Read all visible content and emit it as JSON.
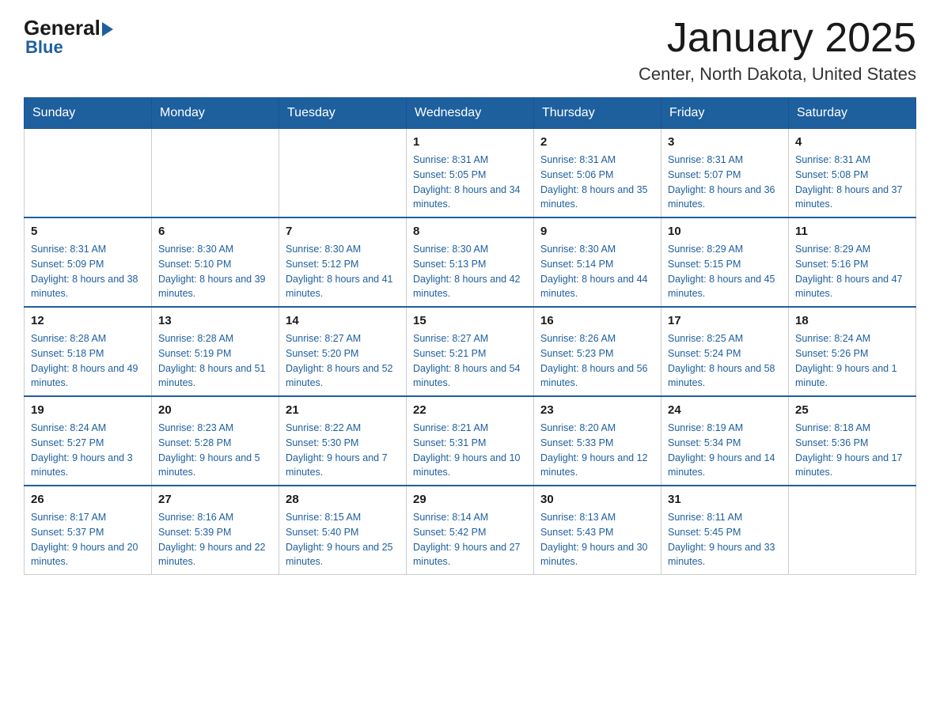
{
  "logo": {
    "general": "General",
    "blue": "Blue"
  },
  "title": "January 2025",
  "subtitle": "Center, North Dakota, United States",
  "days_of_week": [
    "Sunday",
    "Monday",
    "Tuesday",
    "Wednesday",
    "Thursday",
    "Friday",
    "Saturday"
  ],
  "weeks": [
    [
      {
        "day": "",
        "sunrise": "",
        "sunset": "",
        "daylight": ""
      },
      {
        "day": "",
        "sunrise": "",
        "sunset": "",
        "daylight": ""
      },
      {
        "day": "",
        "sunrise": "",
        "sunset": "",
        "daylight": ""
      },
      {
        "day": "1",
        "sunrise": "Sunrise: 8:31 AM",
        "sunset": "Sunset: 5:05 PM",
        "daylight": "Daylight: 8 hours and 34 minutes."
      },
      {
        "day": "2",
        "sunrise": "Sunrise: 8:31 AM",
        "sunset": "Sunset: 5:06 PM",
        "daylight": "Daylight: 8 hours and 35 minutes."
      },
      {
        "day": "3",
        "sunrise": "Sunrise: 8:31 AM",
        "sunset": "Sunset: 5:07 PM",
        "daylight": "Daylight: 8 hours and 36 minutes."
      },
      {
        "day": "4",
        "sunrise": "Sunrise: 8:31 AM",
        "sunset": "Sunset: 5:08 PM",
        "daylight": "Daylight: 8 hours and 37 minutes."
      }
    ],
    [
      {
        "day": "5",
        "sunrise": "Sunrise: 8:31 AM",
        "sunset": "Sunset: 5:09 PM",
        "daylight": "Daylight: 8 hours and 38 minutes."
      },
      {
        "day": "6",
        "sunrise": "Sunrise: 8:30 AM",
        "sunset": "Sunset: 5:10 PM",
        "daylight": "Daylight: 8 hours and 39 minutes."
      },
      {
        "day": "7",
        "sunrise": "Sunrise: 8:30 AM",
        "sunset": "Sunset: 5:12 PM",
        "daylight": "Daylight: 8 hours and 41 minutes."
      },
      {
        "day": "8",
        "sunrise": "Sunrise: 8:30 AM",
        "sunset": "Sunset: 5:13 PM",
        "daylight": "Daylight: 8 hours and 42 minutes."
      },
      {
        "day": "9",
        "sunrise": "Sunrise: 8:30 AM",
        "sunset": "Sunset: 5:14 PM",
        "daylight": "Daylight: 8 hours and 44 minutes."
      },
      {
        "day": "10",
        "sunrise": "Sunrise: 8:29 AM",
        "sunset": "Sunset: 5:15 PM",
        "daylight": "Daylight: 8 hours and 45 minutes."
      },
      {
        "day": "11",
        "sunrise": "Sunrise: 8:29 AM",
        "sunset": "Sunset: 5:16 PM",
        "daylight": "Daylight: 8 hours and 47 minutes."
      }
    ],
    [
      {
        "day": "12",
        "sunrise": "Sunrise: 8:28 AM",
        "sunset": "Sunset: 5:18 PM",
        "daylight": "Daylight: 8 hours and 49 minutes."
      },
      {
        "day": "13",
        "sunrise": "Sunrise: 8:28 AM",
        "sunset": "Sunset: 5:19 PM",
        "daylight": "Daylight: 8 hours and 51 minutes."
      },
      {
        "day": "14",
        "sunrise": "Sunrise: 8:27 AM",
        "sunset": "Sunset: 5:20 PM",
        "daylight": "Daylight: 8 hours and 52 minutes."
      },
      {
        "day": "15",
        "sunrise": "Sunrise: 8:27 AM",
        "sunset": "Sunset: 5:21 PM",
        "daylight": "Daylight: 8 hours and 54 minutes."
      },
      {
        "day": "16",
        "sunrise": "Sunrise: 8:26 AM",
        "sunset": "Sunset: 5:23 PM",
        "daylight": "Daylight: 8 hours and 56 minutes."
      },
      {
        "day": "17",
        "sunrise": "Sunrise: 8:25 AM",
        "sunset": "Sunset: 5:24 PM",
        "daylight": "Daylight: 8 hours and 58 minutes."
      },
      {
        "day": "18",
        "sunrise": "Sunrise: 8:24 AM",
        "sunset": "Sunset: 5:26 PM",
        "daylight": "Daylight: 9 hours and 1 minute."
      }
    ],
    [
      {
        "day": "19",
        "sunrise": "Sunrise: 8:24 AM",
        "sunset": "Sunset: 5:27 PM",
        "daylight": "Daylight: 9 hours and 3 minutes."
      },
      {
        "day": "20",
        "sunrise": "Sunrise: 8:23 AM",
        "sunset": "Sunset: 5:28 PM",
        "daylight": "Daylight: 9 hours and 5 minutes."
      },
      {
        "day": "21",
        "sunrise": "Sunrise: 8:22 AM",
        "sunset": "Sunset: 5:30 PM",
        "daylight": "Daylight: 9 hours and 7 minutes."
      },
      {
        "day": "22",
        "sunrise": "Sunrise: 8:21 AM",
        "sunset": "Sunset: 5:31 PM",
        "daylight": "Daylight: 9 hours and 10 minutes."
      },
      {
        "day": "23",
        "sunrise": "Sunrise: 8:20 AM",
        "sunset": "Sunset: 5:33 PM",
        "daylight": "Daylight: 9 hours and 12 minutes."
      },
      {
        "day": "24",
        "sunrise": "Sunrise: 8:19 AM",
        "sunset": "Sunset: 5:34 PM",
        "daylight": "Daylight: 9 hours and 14 minutes."
      },
      {
        "day": "25",
        "sunrise": "Sunrise: 8:18 AM",
        "sunset": "Sunset: 5:36 PM",
        "daylight": "Daylight: 9 hours and 17 minutes."
      }
    ],
    [
      {
        "day": "26",
        "sunrise": "Sunrise: 8:17 AM",
        "sunset": "Sunset: 5:37 PM",
        "daylight": "Daylight: 9 hours and 20 minutes."
      },
      {
        "day": "27",
        "sunrise": "Sunrise: 8:16 AM",
        "sunset": "Sunset: 5:39 PM",
        "daylight": "Daylight: 9 hours and 22 minutes."
      },
      {
        "day": "28",
        "sunrise": "Sunrise: 8:15 AM",
        "sunset": "Sunset: 5:40 PM",
        "daylight": "Daylight: 9 hours and 25 minutes."
      },
      {
        "day": "29",
        "sunrise": "Sunrise: 8:14 AM",
        "sunset": "Sunset: 5:42 PM",
        "daylight": "Daylight: 9 hours and 27 minutes."
      },
      {
        "day": "30",
        "sunrise": "Sunrise: 8:13 AM",
        "sunset": "Sunset: 5:43 PM",
        "daylight": "Daylight: 9 hours and 30 minutes."
      },
      {
        "day": "31",
        "sunrise": "Sunrise: 8:11 AM",
        "sunset": "Sunset: 5:45 PM",
        "daylight": "Daylight: 9 hours and 33 minutes."
      },
      {
        "day": "",
        "sunrise": "",
        "sunset": "",
        "daylight": ""
      }
    ]
  ]
}
